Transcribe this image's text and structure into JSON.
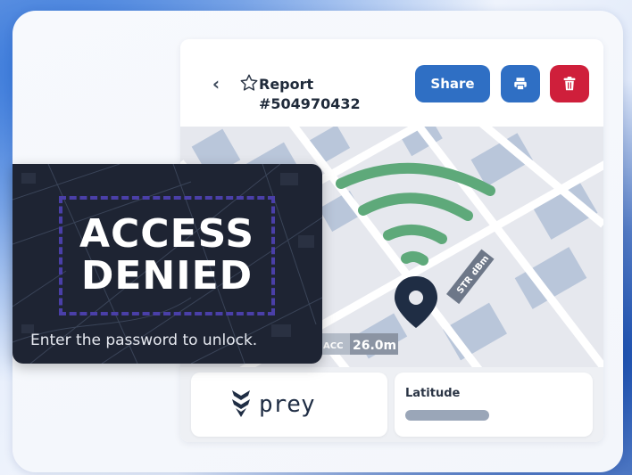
{
  "report": {
    "title": "Report",
    "number": "#504970432"
  },
  "toolbar": {
    "share_label": "Share",
    "print_icon": "printer-icon",
    "delete_icon": "trash-icon",
    "back_icon": "chevron-left-icon",
    "favorite_icon": "star-outline-icon"
  },
  "map": {
    "accuracy_label": "ACC",
    "accuracy_value": "26.0m",
    "strength_label": "STR",
    "strength_unit": "dBm",
    "marker_icon": "location-pin-icon",
    "signal_icon": "wifi-signal-icon"
  },
  "info": {
    "latitude_label": "Latitude",
    "brand_name": "prey"
  },
  "lock_overlay": {
    "line1": "ACCESS",
    "line2": "DENIED",
    "hint": "Enter the password to unlock."
  },
  "colors": {
    "primary": "#2f6fc4",
    "danger": "#cf1f3b",
    "signal": "#5ea97a",
    "pin": "#1f2d44",
    "overlay_bg": "#1e2433",
    "frame": "#4a3fa8"
  }
}
